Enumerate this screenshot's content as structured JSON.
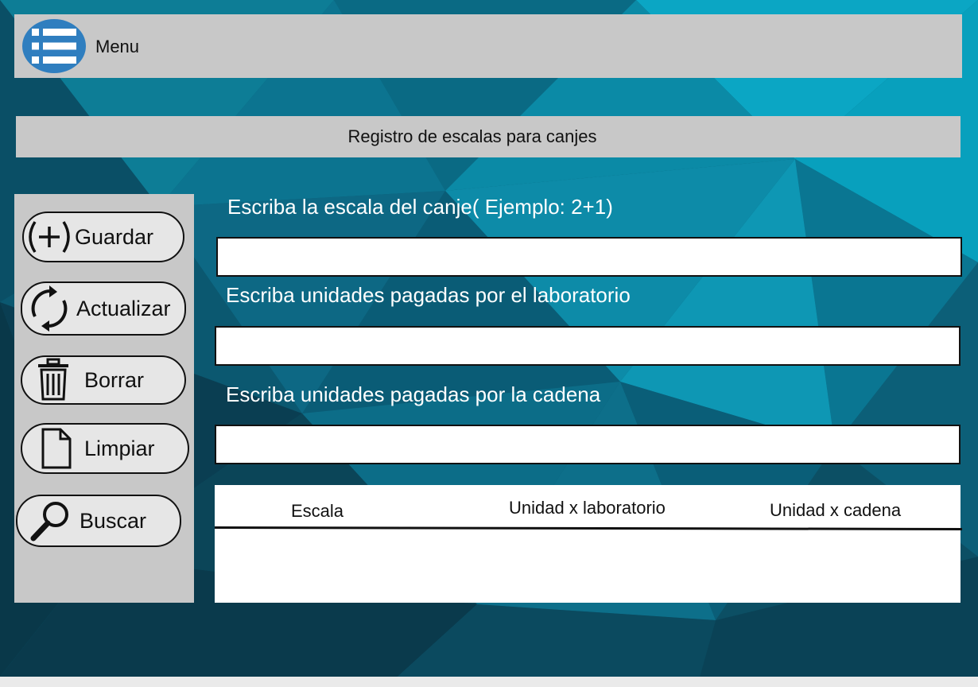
{
  "header": {
    "menu_label": "Menu"
  },
  "page_title": "Registro de escalas para canjes",
  "sidebar": {
    "buttons": [
      {
        "label": "Guardar",
        "icon": "plus-circle-icon"
      },
      {
        "label": "Actualizar",
        "icon": "refresh-icon"
      },
      {
        "label": "Borrar",
        "icon": "trash-icon"
      },
      {
        "label": "Limpiar",
        "icon": "document-icon"
      },
      {
        "label": "Buscar",
        "icon": "magnifier-icon"
      }
    ]
  },
  "form": {
    "scale_prompt": "Escriba la escala del canje( Ejemplo: 2+1)",
    "scale_value": "",
    "lab_units_prompt": "Escriba unidades pagadas por el laboratorio",
    "lab_units_value": "",
    "chain_units_prompt": "Escriba unidades pagadas por la cadena",
    "chain_units_value": ""
  },
  "table": {
    "columns": [
      "Escala",
      "Unidad x laboratorio",
      "Unidad x cadena"
    ],
    "rows": []
  },
  "colors": {
    "panel": "#c8c8c8",
    "menu_icon_blue": "#2f7ebf",
    "background_teal": "#0a6f86"
  }
}
